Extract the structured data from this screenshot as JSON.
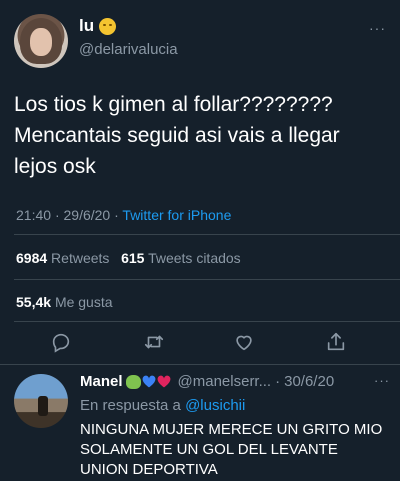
{
  "tweet": {
    "display_name": "lu",
    "name_emoji": "sun-face-emoji",
    "handle": "@delarivalucia",
    "more": "···",
    "text": "Los tios k gimen al follar????????\nMencantais seguid asi vais a llegar\nlejos osk",
    "time": "21:40",
    "date": "29/6/20",
    "separator": "·",
    "source": "Twitter for iPhone",
    "retweets_count": "6984",
    "retweets_label": "Retweets",
    "quotes_count": "615",
    "quotes_label": "Tweets citados",
    "likes_count": "55,4k",
    "likes_label": "Me gusta"
  },
  "actions": [
    {
      "name": "reply-icon"
    },
    {
      "name": "retweet-icon"
    },
    {
      "name": "like-icon"
    },
    {
      "name": "share-icon"
    }
  ],
  "reply": {
    "display_name": "Manel",
    "name_emojis": [
      "frog-emoji",
      "blue-heart-emoji",
      "red-heart-emoji"
    ],
    "handle": "@manelserr...",
    "separator": "·",
    "date": "30/6/20",
    "more": "···",
    "in_reply_label": "En respuesta a",
    "in_reply_mention": "@lusichii",
    "text": "NINGUNA MUJER MERECE UN GRITO MIO\nSOLAMENTE UN GOL DEL LEVANTE\nUNION DEPORTIVA"
  },
  "colors": {
    "background": "#15202b",
    "text": "#ffffff",
    "secondary": "#8b98a5",
    "accent": "#1d9bf0",
    "divider": "#38444d"
  }
}
